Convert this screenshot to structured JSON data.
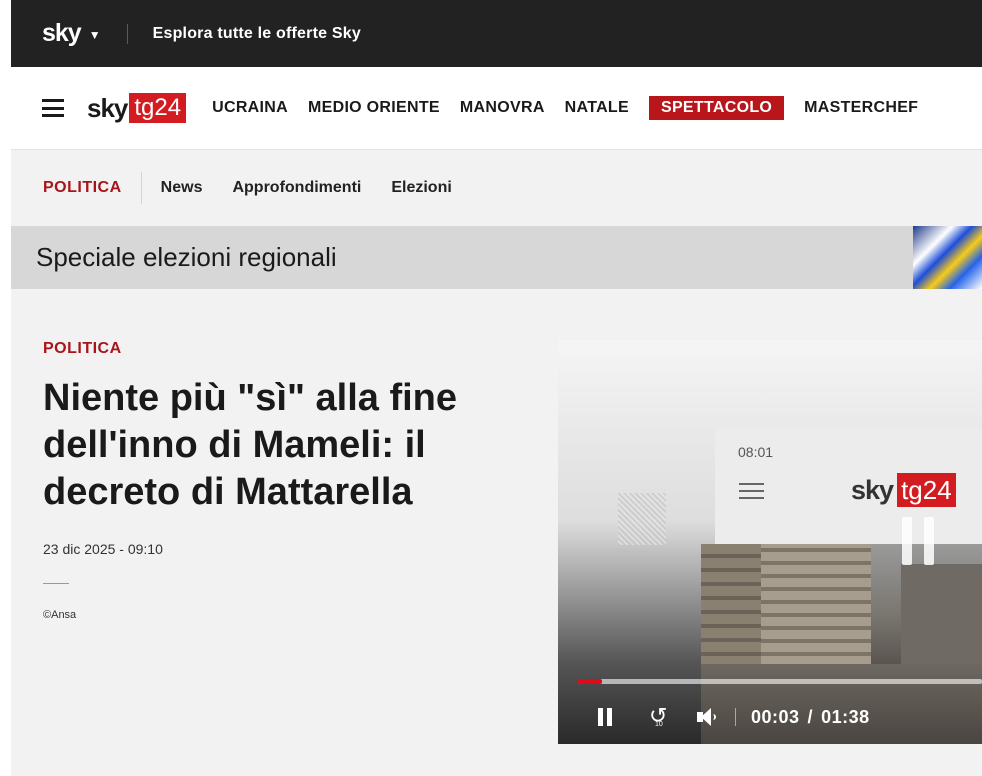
{
  "skybar": {
    "logo": "sky",
    "offers": "Esplora tutte le offerte Sky"
  },
  "mainnav": {
    "logo_sky": "sky",
    "logo_tg": "tg24",
    "items": [
      {
        "label": "UCRAINA"
      },
      {
        "label": "MEDIO ORIENTE"
      },
      {
        "label": "MANOVRA"
      },
      {
        "label": "NATALE"
      },
      {
        "label": "SPETTACOLO"
      },
      {
        "label": "MASTERCHEF"
      }
    ],
    "active_index": 4
  },
  "subnav": {
    "section": "POLITICA",
    "links": [
      {
        "label": "News"
      },
      {
        "label": "Approfondimenti"
      },
      {
        "label": "Elezioni"
      }
    ]
  },
  "banner": {
    "title": "Speciale elezioni regionali"
  },
  "article": {
    "section": "POLITICA",
    "title": "Niente più \"sì\" alla fine dell'inno di Mameli: il decreto di Mattarella",
    "date": "23 dic 2025 - 09:10",
    "credit": "©Ansa"
  },
  "player": {
    "screen_time": "08:01",
    "screen_logo_sky": "sky",
    "screen_logo_tg": "tg24",
    "current_time": "00:03",
    "separator": "/",
    "duration": "01:38",
    "progress_fraction": 0.06,
    "replay_seconds": "10"
  },
  "colors": {
    "brand_red": "#d31c20",
    "section_red": "#a8141a",
    "topbar": "#222222",
    "progress": "#e1081b"
  }
}
